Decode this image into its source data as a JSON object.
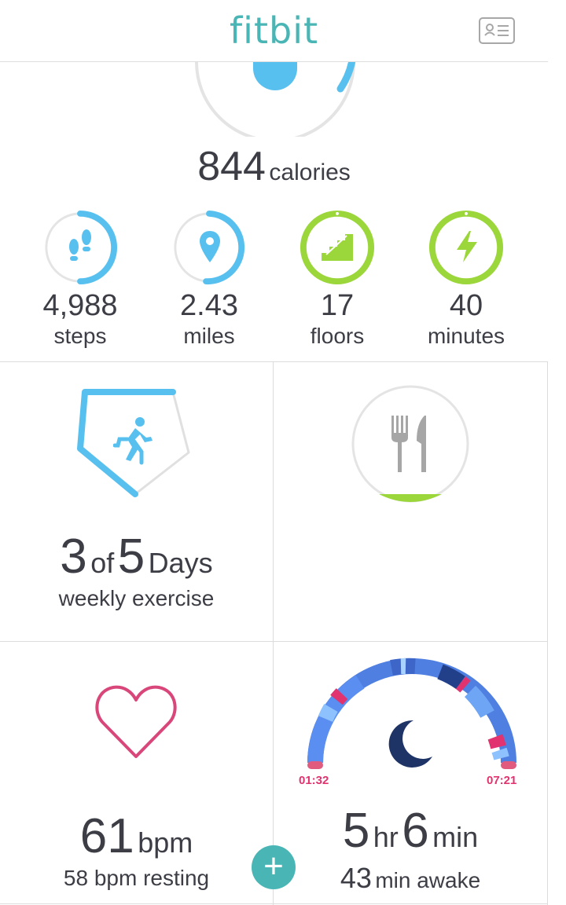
{
  "header": {
    "logo": "fitbit",
    "card_icon": "id-card-icon"
  },
  "calories": {
    "value": "844",
    "unit": "calories",
    "progress": 0.3
  },
  "stats": [
    {
      "value": "4,988",
      "label": "steps",
      "icon": "footsteps-icon",
      "progress": 0.5,
      "color": "#58c0ef"
    },
    {
      "value": "2.43",
      "label": "miles",
      "icon": "location-pin-icon",
      "progress": 0.48,
      "color": "#58c0ef"
    },
    {
      "value": "17",
      "label": "floors",
      "icon": "stairs-icon",
      "progress": 1.0,
      "color": "#9bd63a"
    },
    {
      "value": "40",
      "label": "minutes",
      "icon": "lightning-icon",
      "progress": 1.0,
      "color": "#9bd63a"
    }
  ],
  "exercise": {
    "count": "3",
    "of": "of",
    "goal": "5",
    "unit": "Days",
    "label": "weekly exercise",
    "progress": 0.6
  },
  "food": {
    "icon": "fork-knife-icon",
    "progress": 0.08
  },
  "heart": {
    "value": "61",
    "unit": "bpm",
    "resting": "58 bpm resting",
    "icon": "heart-icon",
    "color": "#d9477a"
  },
  "sleep": {
    "hours": "5",
    "hr": "hr",
    "minutes": "6",
    "min": "min",
    "awake_value": "43",
    "awake_label": "min awake",
    "start": "01:32",
    "end": "07:21",
    "icon": "moon-icon"
  },
  "fab": {
    "label": "+"
  },
  "colors": {
    "accent": "#49b6b5",
    "blue": "#58c0ef",
    "green": "#9bd63a",
    "pink": "#e0336f"
  }
}
